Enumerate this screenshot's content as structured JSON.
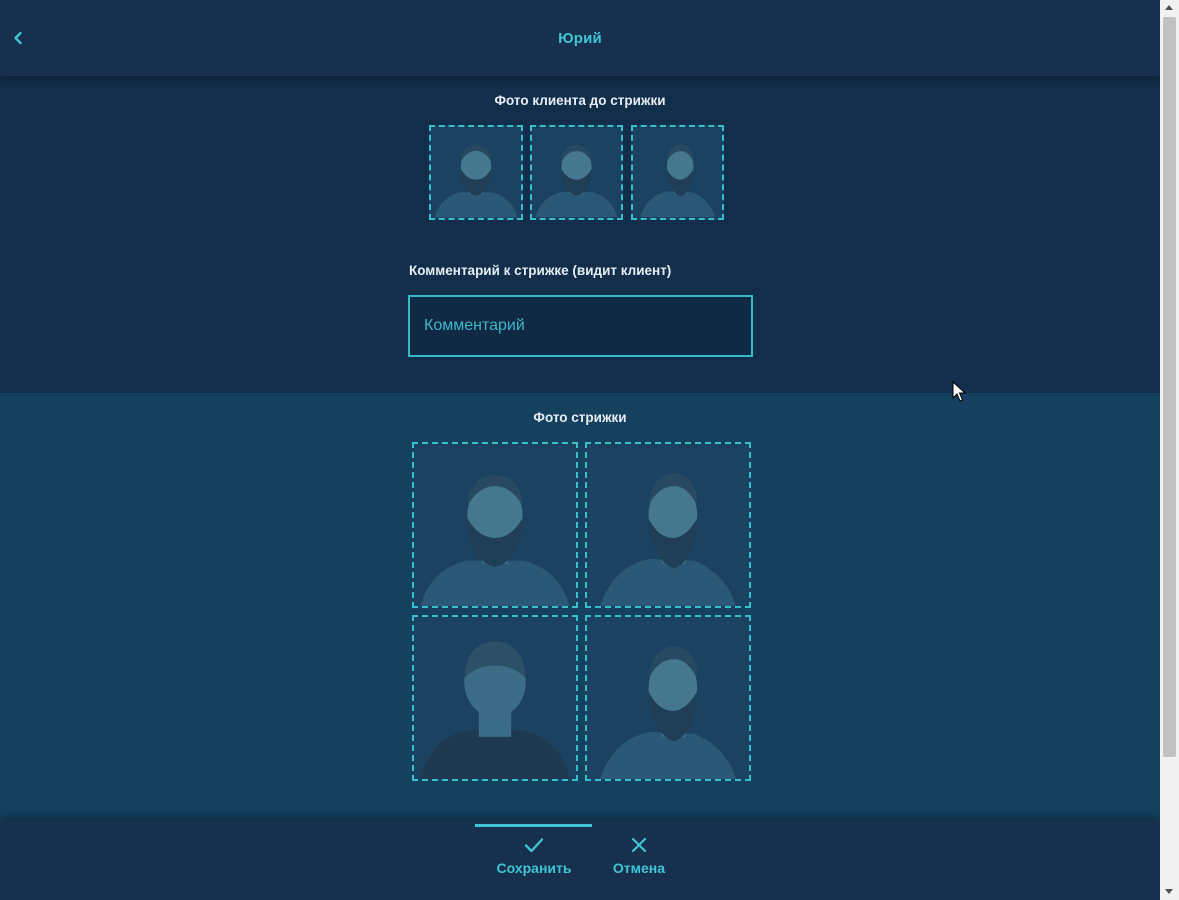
{
  "header": {
    "title": "Юрий",
    "back_icon": "chevron-left-icon"
  },
  "before_photos": {
    "title": "Фото клиента до стрижки",
    "slots": [
      {
        "view": "front"
      },
      {
        "view": "front-slight-turn"
      },
      {
        "view": "three-quarter"
      }
    ]
  },
  "comment": {
    "label": "Комментарий к стрижке (видит клиент)",
    "value": "",
    "placeholder": "Комментарий"
  },
  "haircut_photos": {
    "title": "Фото стрижки",
    "slots": [
      {
        "view": "front"
      },
      {
        "view": "three-quarter"
      },
      {
        "view": "back"
      },
      {
        "view": "side"
      }
    ]
  },
  "footer": {
    "save_label": "Сохранить",
    "save_icon": "check-icon",
    "cancel_label": "Отмена",
    "cancel_icon": "close-icon",
    "active_tab": "save"
  },
  "colors": {
    "accent": "#3fc5d3",
    "header_bg": "#16304e",
    "section_top_bg": "#122e4b",
    "section_bottom_bg": "#15415f",
    "text_light": "#e6edf3"
  }
}
